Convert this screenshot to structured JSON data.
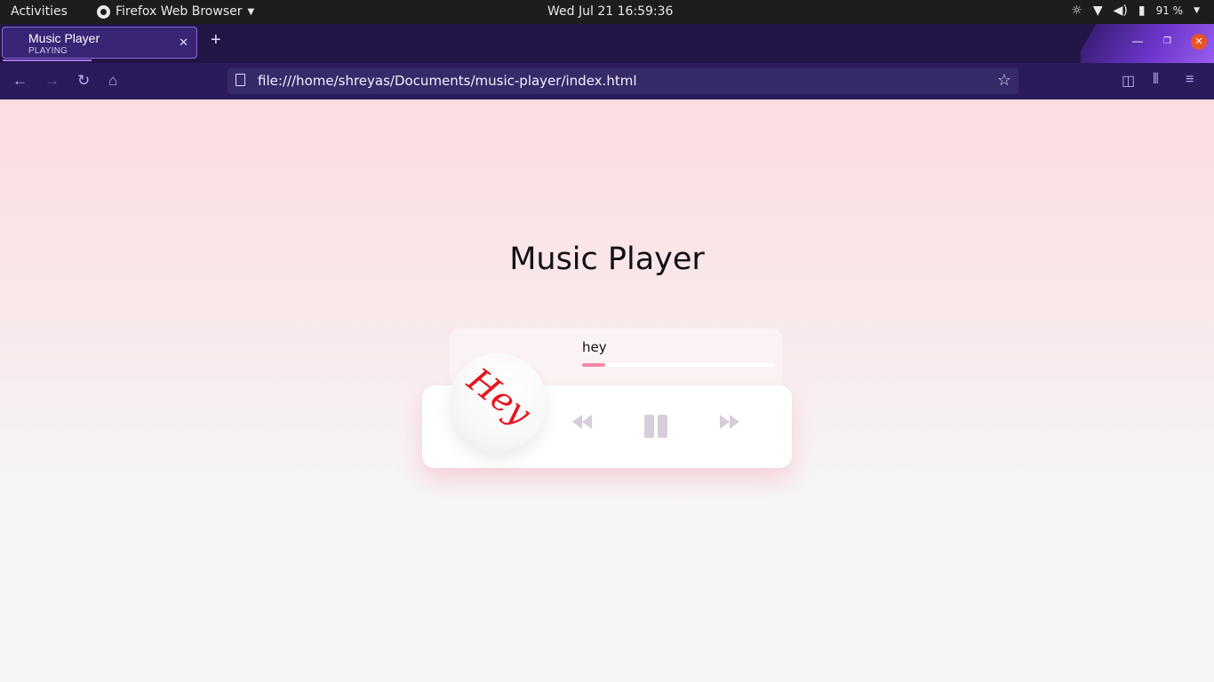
{
  "system_bar": {
    "activities": "Activities",
    "app_name": "Firefox Web Browser",
    "clock": "Wed Jul 21  16:59:36",
    "battery": "91 %"
  },
  "tab": {
    "title": "Music Player",
    "status": "PLAYING"
  },
  "navbar": {
    "url": "file:///home/shreyas/Documents/music-player/index.html"
  },
  "page": {
    "title": "Music Player",
    "track_name": "hey",
    "album_art_text": "Hey",
    "progress": 0.12
  },
  "colors": {
    "accent": "#f48aa8",
    "controls": "#d7cdd9",
    "art_text": "#e8141c"
  }
}
